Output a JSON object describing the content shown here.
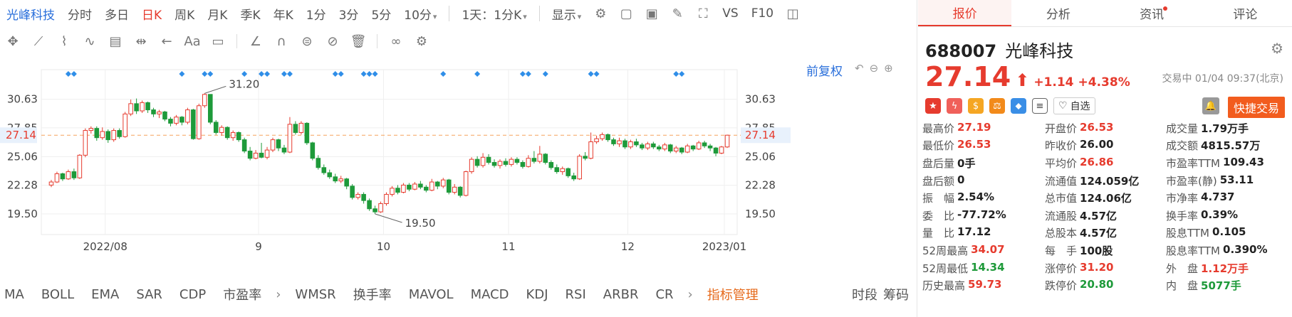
{
  "toolbar": {
    "stock_name": "光峰科技",
    "periods": [
      "分时",
      "多日",
      "日K",
      "周K",
      "月K",
      "季K",
      "年K",
      "1分",
      "3分",
      "5分",
      "10分"
    ],
    "active_period": "日K",
    "interval_select": "1天：1分K",
    "display_label": "显示",
    "vs_label": "VS",
    "f10_label": "F10"
  },
  "drawing_tools": {
    "text_tool": "Aa"
  },
  "chart": {
    "adjust_label": "前复权",
    "current_price_label": "27.14",
    "high_label": "31.20",
    "low_label": "19.50"
  },
  "chart_data": {
    "type": "candlestick",
    "title": "",
    "y_ticks": [
      30.63,
      27.85,
      25.06,
      22.28,
      19.5
    ],
    "ylim": [
      17.5,
      33.5
    ],
    "x_tick_labels": [
      "2022/08",
      "9",
      "10",
      "11",
      "12",
      "2023/01"
    ],
    "current_price": 27.14,
    "max_marker": 31.2,
    "min_marker": 19.5,
    "candles": [
      {
        "o": 22.3,
        "c": 22.6,
        "h": 22.8,
        "l": 22.1
      },
      {
        "o": 22.6,
        "c": 23.4,
        "h": 23.6,
        "l": 22.5
      },
      {
        "o": 23.4,
        "c": 22.9,
        "h": 23.5,
        "l": 22.7
      },
      {
        "o": 22.9,
        "c": 23.6,
        "h": 23.8,
        "l": 22.8
      },
      {
        "o": 23.6,
        "c": 23.0,
        "h": 23.9,
        "l": 22.8
      },
      {
        "o": 23.0,
        "c": 25.2,
        "h": 25.3,
        "l": 22.9
      },
      {
        "o": 25.2,
        "c": 27.6,
        "h": 27.8,
        "l": 25.0
      },
      {
        "o": 27.6,
        "c": 27.8,
        "h": 28.0,
        "l": 27.3
      },
      {
        "o": 27.8,
        "c": 26.9,
        "h": 28.0,
        "l": 26.6
      },
      {
        "o": 26.9,
        "c": 27.5,
        "h": 27.9,
        "l": 26.7
      },
      {
        "o": 27.5,
        "c": 26.7,
        "h": 27.7,
        "l": 26.4
      },
      {
        "o": 26.7,
        "c": 27.6,
        "h": 27.8,
        "l": 26.5
      },
      {
        "o": 27.6,
        "c": 27.0,
        "h": 27.8,
        "l": 26.8
      },
      {
        "o": 27.0,
        "c": 29.2,
        "h": 29.4,
        "l": 26.9
      },
      {
        "o": 29.2,
        "c": 30.2,
        "h": 30.6,
        "l": 29.0
      },
      {
        "o": 30.2,
        "c": 29.5,
        "h": 30.7,
        "l": 29.2
      },
      {
        "o": 29.5,
        "c": 30.3,
        "h": 30.5,
        "l": 29.3
      },
      {
        "o": 30.3,
        "c": 29.6,
        "h": 30.4,
        "l": 29.3
      },
      {
        "o": 29.6,
        "c": 29.2,
        "h": 29.8,
        "l": 28.9
      },
      {
        "o": 29.2,
        "c": 29.4,
        "h": 29.6,
        "l": 28.8
      },
      {
        "o": 29.4,
        "c": 28.7,
        "h": 29.5,
        "l": 28.5
      },
      {
        "o": 28.7,
        "c": 28.3,
        "h": 28.9,
        "l": 28.0
      },
      {
        "o": 28.3,
        "c": 28.9,
        "h": 29.1,
        "l": 28.1
      },
      {
        "o": 28.9,
        "c": 28.4,
        "h": 29.0,
        "l": 28.1
      },
      {
        "o": 28.4,
        "c": 29.6,
        "h": 29.8,
        "l": 28.2
      },
      {
        "o": 29.6,
        "c": 26.8,
        "h": 29.7,
        "l": 26.7
      },
      {
        "o": 26.8,
        "c": 30.0,
        "h": 30.2,
        "l": 26.7
      },
      {
        "o": 30.0,
        "c": 31.1,
        "h": 31.2,
        "l": 29.8
      },
      {
        "o": 31.1,
        "c": 28.4,
        "h": 31.1,
        "l": 28.2
      },
      {
        "o": 28.4,
        "c": 27.4,
        "h": 28.6,
        "l": 27.2
      },
      {
        "o": 27.4,
        "c": 27.9,
        "h": 28.1,
        "l": 27.1
      },
      {
        "o": 27.9,
        "c": 26.9,
        "h": 28.0,
        "l": 26.7
      },
      {
        "o": 26.9,
        "c": 27.4,
        "h": 27.6,
        "l": 26.6
      },
      {
        "o": 27.4,
        "c": 26.7,
        "h": 27.5,
        "l": 26.5
      },
      {
        "o": 26.7,
        "c": 25.6,
        "h": 26.9,
        "l": 25.4
      },
      {
        "o": 25.6,
        "c": 24.9,
        "h": 26.0,
        "l": 24.7
      },
      {
        "o": 24.9,
        "c": 25.4,
        "h": 25.7,
        "l": 24.8
      },
      {
        "o": 25.4,
        "c": 25.0,
        "h": 26.4,
        "l": 24.9
      },
      {
        "o": 25.0,
        "c": 25.7,
        "h": 26.0,
        "l": 24.8
      },
      {
        "o": 25.7,
        "c": 26.7,
        "h": 26.9,
        "l": 25.5
      },
      {
        "o": 26.7,
        "c": 25.9,
        "h": 26.8,
        "l": 25.6
      },
      {
        "o": 25.9,
        "c": 25.5,
        "h": 26.2,
        "l": 25.3
      },
      {
        "o": 25.5,
        "c": 28.2,
        "h": 28.9,
        "l": 25.4
      },
      {
        "o": 28.2,
        "c": 27.4,
        "h": 28.5,
        "l": 27.2
      },
      {
        "o": 27.4,
        "c": 28.3,
        "h": 28.5,
        "l": 27.2
      },
      {
        "o": 28.3,
        "c": 26.4,
        "h": 28.4,
        "l": 26.2
      },
      {
        "o": 26.4,
        "c": 24.9,
        "h": 26.5,
        "l": 24.7
      },
      {
        "o": 24.9,
        "c": 24.0,
        "h": 25.2,
        "l": 23.8
      },
      {
        "o": 24.0,
        "c": 23.5,
        "h": 24.3,
        "l": 23.3
      },
      {
        "o": 23.5,
        "c": 23.1,
        "h": 23.8,
        "l": 22.9
      },
      {
        "o": 23.1,
        "c": 22.7,
        "h": 23.4,
        "l": 22.5
      },
      {
        "o": 22.7,
        "c": 22.9,
        "h": 23.2,
        "l": 22.5
      },
      {
        "o": 22.9,
        "c": 22.2,
        "h": 23.0,
        "l": 21.9
      },
      {
        "o": 22.2,
        "c": 21.1,
        "h": 22.4,
        "l": 20.9
      },
      {
        "o": 21.1,
        "c": 21.4,
        "h": 21.6,
        "l": 20.9
      },
      {
        "o": 21.4,
        "c": 20.8,
        "h": 21.6,
        "l": 20.5
      },
      {
        "o": 20.8,
        "c": 20.0,
        "h": 21.0,
        "l": 19.8
      },
      {
        "o": 20.0,
        "c": 19.7,
        "h": 20.3,
        "l": 19.5
      },
      {
        "o": 19.7,
        "c": 20.5,
        "h": 20.7,
        "l": 19.6
      },
      {
        "o": 20.5,
        "c": 21.4,
        "h": 21.6,
        "l": 20.3
      },
      {
        "o": 21.4,
        "c": 22.0,
        "h": 22.2,
        "l": 21.2
      },
      {
        "o": 22.0,
        "c": 21.6,
        "h": 22.3,
        "l": 21.4
      },
      {
        "o": 21.6,
        "c": 22.3,
        "h": 22.5,
        "l": 21.5
      },
      {
        "o": 22.3,
        "c": 21.9,
        "h": 22.5,
        "l": 21.7
      },
      {
        "o": 21.9,
        "c": 22.4,
        "h": 22.6,
        "l": 21.8
      },
      {
        "o": 22.4,
        "c": 22.1,
        "h": 22.7,
        "l": 21.9
      },
      {
        "o": 22.1,
        "c": 21.8,
        "h": 22.3,
        "l": 21.6
      },
      {
        "o": 21.8,
        "c": 22.6,
        "h": 22.9,
        "l": 21.7
      },
      {
        "o": 22.6,
        "c": 22.2,
        "h": 22.7,
        "l": 21.9
      },
      {
        "o": 22.2,
        "c": 22.8,
        "h": 23.0,
        "l": 22.0
      },
      {
        "o": 22.8,
        "c": 21.6,
        "h": 22.9,
        "l": 21.4
      },
      {
        "o": 21.6,
        "c": 22.1,
        "h": 22.4,
        "l": 21.4
      },
      {
        "o": 22.1,
        "c": 21.3,
        "h": 22.2,
        "l": 21.1
      },
      {
        "o": 21.3,
        "c": 23.6,
        "h": 23.7,
        "l": 21.2
      },
      {
        "o": 23.6,
        "c": 24.8,
        "h": 25.0,
        "l": 23.4
      },
      {
        "o": 24.8,
        "c": 24.2,
        "h": 25.1,
        "l": 24.0
      },
      {
        "o": 24.2,
        "c": 25.0,
        "h": 25.4,
        "l": 24.0
      },
      {
        "o": 25.0,
        "c": 24.5,
        "h": 25.3,
        "l": 24.3
      },
      {
        "o": 24.5,
        "c": 24.2,
        "h": 24.8,
        "l": 24.0
      },
      {
        "o": 24.2,
        "c": 24.6,
        "h": 24.8,
        "l": 23.9
      },
      {
        "o": 24.6,
        "c": 24.3,
        "h": 24.9,
        "l": 24.1
      },
      {
        "o": 24.3,
        "c": 24.8,
        "h": 25.0,
        "l": 24.1
      },
      {
        "o": 24.8,
        "c": 24.5,
        "h": 25.0,
        "l": 24.3
      },
      {
        "o": 24.5,
        "c": 24.1,
        "h": 24.7,
        "l": 23.9
      },
      {
        "o": 24.1,
        "c": 24.9,
        "h": 25.2,
        "l": 24.0
      },
      {
        "o": 24.9,
        "c": 24.6,
        "h": 25.6,
        "l": 24.4
      },
      {
        "o": 24.6,
        "c": 25.3,
        "h": 26.1,
        "l": 24.4
      },
      {
        "o": 25.3,
        "c": 24.5,
        "h": 25.4,
        "l": 24.3
      },
      {
        "o": 24.5,
        "c": 24.0,
        "h": 24.7,
        "l": 23.8
      },
      {
        "o": 24.0,
        "c": 23.6,
        "h": 24.3,
        "l": 23.4
      },
      {
        "o": 23.6,
        "c": 23.9,
        "h": 24.1,
        "l": 23.3
      },
      {
        "o": 23.9,
        "c": 23.2,
        "h": 24.0,
        "l": 23.0
      },
      {
        "o": 23.2,
        "c": 22.9,
        "h": 23.5,
        "l": 22.7
      },
      {
        "o": 22.9,
        "c": 25.1,
        "h": 25.3,
        "l": 22.8
      },
      {
        "o": 25.1,
        "c": 24.9,
        "h": 25.5,
        "l": 24.7
      },
      {
        "o": 24.9,
        "c": 26.5,
        "h": 27.4,
        "l": 24.8
      },
      {
        "o": 26.5,
        "c": 26.8,
        "h": 27.1,
        "l": 26.3
      },
      {
        "o": 26.8,
        "c": 27.2,
        "h": 27.4,
        "l": 26.6
      },
      {
        "o": 27.2,
        "c": 26.7,
        "h": 27.3,
        "l": 26.5
      },
      {
        "o": 26.7,
        "c": 26.3,
        "h": 26.9,
        "l": 26.1
      },
      {
        "o": 26.3,
        "c": 26.6,
        "h": 26.9,
        "l": 26.0
      },
      {
        "o": 26.6,
        "c": 26.0,
        "h": 26.8,
        "l": 25.8
      },
      {
        "o": 26.0,
        "c": 26.5,
        "h": 26.7,
        "l": 25.8
      },
      {
        "o": 26.5,
        "c": 26.2,
        "h": 26.8,
        "l": 26.0
      },
      {
        "o": 26.2,
        "c": 25.9,
        "h": 26.4,
        "l": 25.7
      },
      {
        "o": 25.9,
        "c": 26.3,
        "h": 26.5,
        "l": 25.7
      },
      {
        "o": 26.3,
        "c": 26.0,
        "h": 26.5,
        "l": 25.8
      },
      {
        "o": 26.0,
        "c": 25.8,
        "h": 26.2,
        "l": 25.6
      },
      {
        "o": 25.8,
        "c": 26.2,
        "h": 26.4,
        "l": 25.6
      },
      {
        "o": 26.2,
        "c": 25.6,
        "h": 26.3,
        "l": 25.4
      },
      {
        "o": 25.6,
        "c": 25.9,
        "h": 26.1,
        "l": 25.4
      },
      {
        "o": 25.9,
        "c": 25.5,
        "h": 26.0,
        "l": 25.3
      },
      {
        "o": 25.5,
        "c": 26.1,
        "h": 26.3,
        "l": 25.4
      },
      {
        "o": 26.1,
        "c": 25.8,
        "h": 26.2,
        "l": 25.6
      },
      {
        "o": 25.8,
        "c": 26.4,
        "h": 26.6,
        "l": 25.7
      },
      {
        "o": 26.4,
        "c": 26.1,
        "h": 26.6,
        "l": 25.9
      },
      {
        "o": 26.1,
        "c": 25.9,
        "h": 26.3,
        "l": 25.6
      },
      {
        "o": 25.9,
        "c": 25.4,
        "h": 26.0,
        "l": 25.1
      },
      {
        "o": 25.4,
        "c": 26.0,
        "h": 26.1,
        "l": 25.3
      },
      {
        "o": 26.0,
        "c": 27.14,
        "h": 27.19,
        "l": 25.9
      }
    ],
    "signal_markers_count": 24
  },
  "indicators": {
    "items_a": [
      "MA",
      "BOLL",
      "EMA",
      "SAR",
      "CDP",
      "市盈率"
    ],
    "items_b": [
      "WMSR",
      "换手率",
      "MAVOL",
      "MACD",
      "KDJ",
      "RSI",
      "ARBR",
      "CR"
    ],
    "manage": "指标管理",
    "time_segment": "时段",
    "chips": "筹码"
  },
  "right": {
    "tabs": [
      "报价",
      "分析",
      "资讯",
      "评论"
    ],
    "code": "688007",
    "name": "光峰科技",
    "price": "27.14",
    "change": "+1.14",
    "pct": "+4.38%",
    "status": "交易中 01/04 09:37(北京)",
    "watch_label": "自选",
    "quick_trade": "快捷交易",
    "quote_rows": [
      [
        {
          "l": "最高价",
          "v": "27.19",
          "c": "red"
        },
        {
          "l": "开盘价",
          "v": "26.53",
          "c": "red"
        },
        {
          "l": "成交量",
          "v": "1.79万手",
          "c": ""
        }
      ],
      [
        {
          "l": "最低价",
          "v": "26.53",
          "c": "red"
        },
        {
          "l": "昨收价",
          "v": "26.00",
          "c": ""
        },
        {
          "l": "成交额",
          "v": "4815.57万",
          "c": ""
        }
      ],
      [
        {
          "l": "盘后量",
          "v": "0手",
          "c": ""
        },
        {
          "l": "平均价",
          "v": "26.86",
          "c": "red"
        },
        {
          "l": "市盈率TTM",
          "v": "109.43",
          "c": ""
        }
      ],
      [
        {
          "l": "盘后额",
          "v": "0",
          "c": ""
        },
        {
          "l": "流通值",
          "v": "124.059亿",
          "c": ""
        },
        {
          "l": "市盈率(静)",
          "v": "53.11",
          "c": ""
        }
      ],
      [
        {
          "l": "振　幅",
          "v": "2.54%",
          "c": ""
        },
        {
          "l": "总市值",
          "v": "124.06亿",
          "c": ""
        },
        {
          "l": "市净率",
          "v": "4.737",
          "c": ""
        }
      ],
      [
        {
          "l": "委　比",
          "v": "-77.72%",
          "c": ""
        },
        {
          "l": "流通股",
          "v": "4.57亿",
          "c": ""
        },
        {
          "l": "换手率",
          "v": "0.39%",
          "c": ""
        }
      ],
      [
        {
          "l": "量　比",
          "v": "17.12",
          "c": ""
        },
        {
          "l": "总股本",
          "v": "4.57亿",
          "c": ""
        },
        {
          "l": "股息TTM",
          "v": "0.105",
          "c": ""
        }
      ],
      [
        {
          "l": "52周最高",
          "v": "34.07",
          "c": "red"
        },
        {
          "l": "每　手",
          "v": "100股",
          "c": ""
        },
        {
          "l": "股息率TTM",
          "v": "0.390%",
          "c": ""
        }
      ],
      [
        {
          "l": "52周最低",
          "v": "14.34",
          "c": "green"
        },
        {
          "l": "涨停价",
          "v": "31.20",
          "c": "red"
        },
        {
          "l": "外　盘",
          "v": "1.12万手",
          "c": "red"
        }
      ],
      [
        {
          "l": "历史最高",
          "v": "59.73",
          "c": "red"
        },
        {
          "l": "跌停价",
          "v": "20.80",
          "c": "green"
        },
        {
          "l": "内　盘",
          "v": "5077手",
          "c": "green"
        }
      ]
    ]
  },
  "colors": {
    "up": "#e63b2e",
    "down": "#1e9a3a",
    "accent": "#2a6fdb",
    "orange": "#f25c1e"
  }
}
